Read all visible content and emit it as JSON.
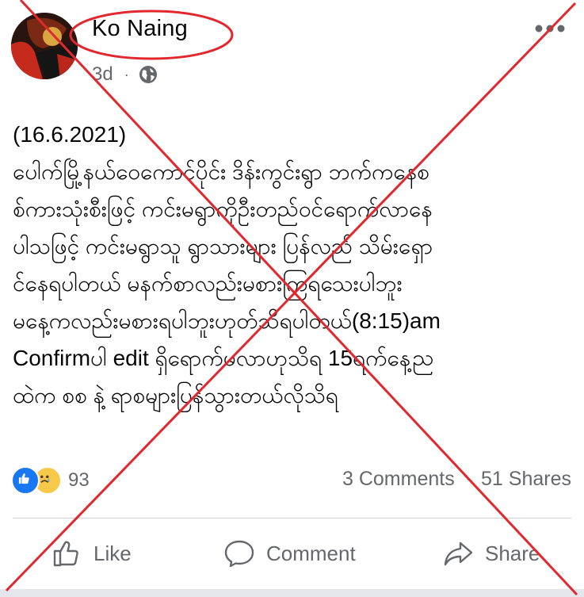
{
  "post": {
    "author": "Ko Naing",
    "time": "3d",
    "separator": "·",
    "body_lines": [
      "(16.6.2021)",
      "ပေါက်မြို့နယ်ဝေကောင်ပိုင်း ဒိန်းကွင်းရွာ ဘက်ကနေစ",
      "စ်ကားသုံးစီးဖြင့် ကင်းမရွာကိုဦးတည်ဝင်ရောက်လာနေ",
      "ပါသဖြင့် ကင်းမရွာသူ ရွာသားများ ပြန်လည် သိမ်းရှော",
      "င်နေရပါတယ် မနက်စာလည်းမစားကြရသေးပါဘူး",
      "မနေ့ကလည်းမစားရပါဘူးဟုတ်သိရပါတယ်(8:15)am",
      "Confirmပါ edit ရှိရောက်မလာဟုသိရ 15ရက်နေ့ည",
      "ထဲက စစ နဲ့ ရာစများပြန်သွားတယ်လိုသိရ"
    ]
  },
  "reactions": {
    "count": "93",
    "comments": "3 Comments",
    "shares": "51 Shares",
    "separator": "·"
  },
  "actions": {
    "like": "Like",
    "comment": "Comment",
    "share": "Share"
  },
  "icons": {
    "avatar": "profile-picture",
    "globe": "globe-icon",
    "more": "more-options-icon",
    "like_reaction": "like-reaction-icon",
    "sad_reaction": "sad-reaction-icon",
    "like": "thumbs-up-icon",
    "comment": "comment-bubble-icon",
    "share": "share-arrow-icon"
  },
  "colors": {
    "annotation_red": "#e0282e",
    "fb_blue": "#1877f2",
    "meta_gray": "#65676b"
  }
}
